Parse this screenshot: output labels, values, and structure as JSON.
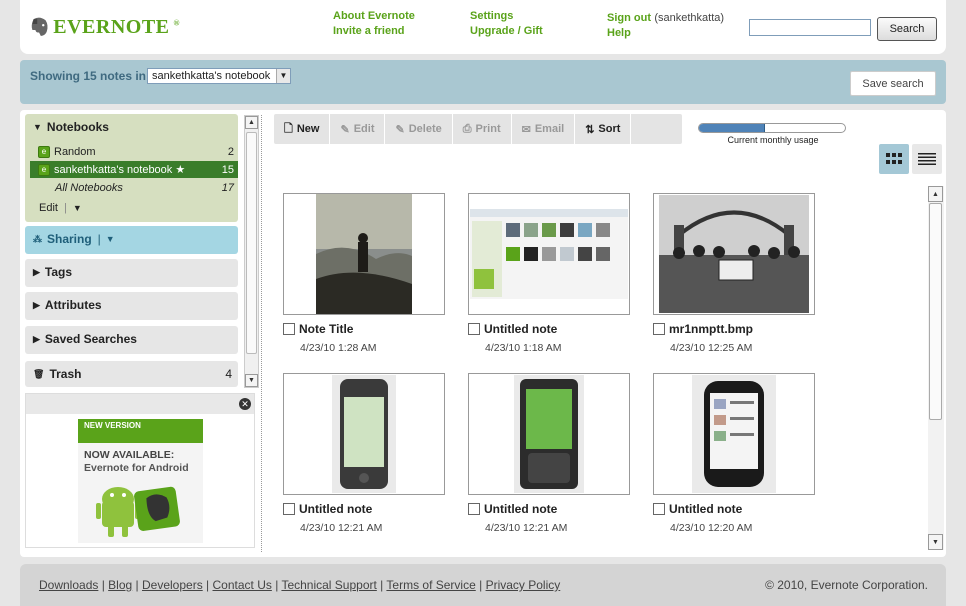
{
  "header": {
    "logo_text": "EVERNOTE",
    "links_col1": [
      "About Evernote",
      "Invite a friend"
    ],
    "links_col2": [
      "Settings",
      "Upgrade / Gift"
    ],
    "sign_out": "Sign out",
    "username": "(sankethkatta)",
    "help": "Help",
    "search_value": "",
    "search_button": "Search"
  },
  "showing": {
    "label": "Showing 15 notes in",
    "notebook": "sankethkatta's notebook",
    "save_search": "Save search"
  },
  "sidebar": {
    "notebooks_title": "Notebooks",
    "notebooks": [
      {
        "name": "Random",
        "count": "2"
      },
      {
        "name": "sankethkatta's notebook ★",
        "count": "15"
      },
      {
        "name": "All Notebooks",
        "count": "17"
      }
    ],
    "edit_label": "Edit",
    "sharing": "Sharing",
    "tags": "Tags",
    "attributes": "Attributes",
    "saved_searches": "Saved Searches",
    "trash": "Trash",
    "trash_count": "4"
  },
  "ad": {
    "badge": "NEW VERSION",
    "line1": "NOW AVAILABLE:",
    "line2": "Evernote for Android"
  },
  "toolbar": {
    "new": "New",
    "edit": "Edit",
    "delete": "Delete",
    "print": "Print",
    "email": "Email",
    "sort": "Sort"
  },
  "usage": {
    "label": "Current monthly usage",
    "fraction": 0.45
  },
  "notes": [
    {
      "title": "Note Title",
      "date": "4/23/10 1:28 AM"
    },
    {
      "title": "Untitled note",
      "date": "4/23/10 1:18 AM"
    },
    {
      "title": "mr1nmptt.bmp",
      "date": "4/23/10 12:25 AM"
    },
    {
      "title": "Untitled note",
      "date": "4/23/10 12:21 AM"
    },
    {
      "title": "Untitled note",
      "date": "4/23/10 12:21 AM"
    },
    {
      "title": "Untitled note",
      "date": "4/23/10 12:20 AM"
    }
  ],
  "footer": {
    "links": [
      "Downloads",
      "Blog",
      "Developers",
      "Contact Us",
      "Technical Support",
      "Terms of Service",
      "Privacy Policy"
    ],
    "copyright": "© 2010, Evernote Corporation."
  },
  "colors": {
    "brand_green": "#5aa31a",
    "bar_blue": "#a9c7d1",
    "selected_notebook": "#3a7d2a"
  }
}
